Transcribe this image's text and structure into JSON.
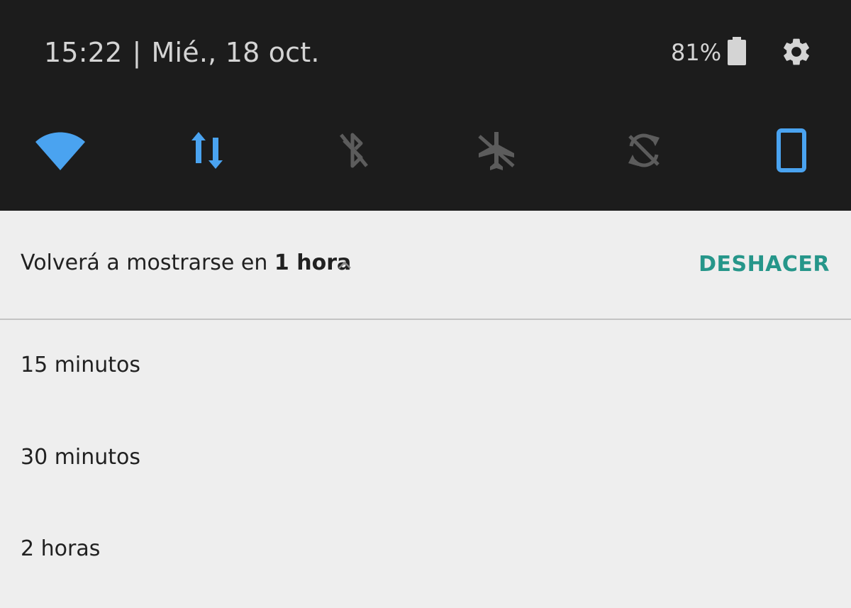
{
  "status": {
    "time": "15:22",
    "separator": "|",
    "date": "Mié., 18 oct.",
    "battery_percent": "81%",
    "battery_level": 0.81
  },
  "quick_tiles": [
    {
      "name": "wifi-icon",
      "active": true
    },
    {
      "name": "mobile-data-icon",
      "active": true
    },
    {
      "name": "bluetooth-off-icon",
      "active": false
    },
    {
      "name": "airplane-mode-off-icon",
      "active": false
    },
    {
      "name": "auto-rotate-off-icon",
      "active": false
    },
    {
      "name": "phone-portrait-icon",
      "active": true
    }
  ],
  "colors": {
    "shade_bg": "#1c1c1c",
    "tile_active": "#4aa3f0",
    "tile_inactive": "#5c5c5c",
    "accent": "#26968a",
    "panel_bg": "#eeeeee"
  },
  "snooze": {
    "prefix": "Volverá a mostrarse en ",
    "duration": "1 hora",
    "undo_label": "DESHACER",
    "options": [
      "15 minutos",
      "30 minutos",
      "2 horas"
    ]
  }
}
